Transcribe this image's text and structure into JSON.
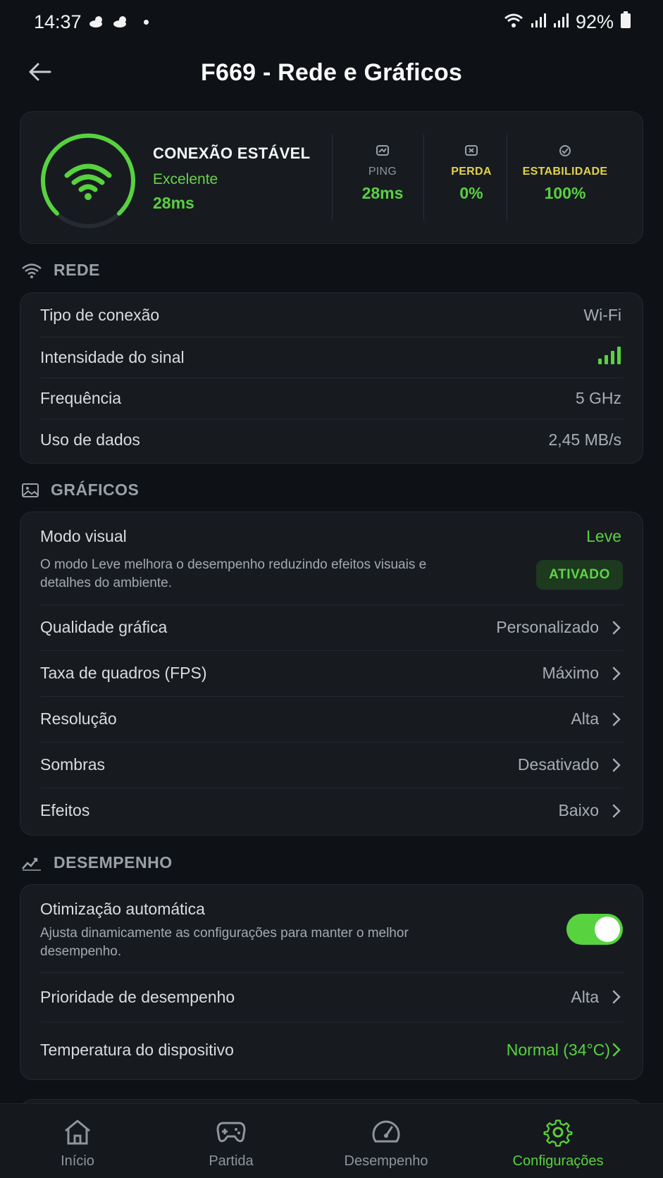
{
  "status_bar": {
    "time": "14:37",
    "battery": "92%"
  },
  "header": {
    "title": "F669 - Rede e Gráficos"
  },
  "connection": {
    "title": "CONEXÃO ESTÁVEL",
    "quality": "Excelente",
    "latency": "28ms",
    "metrics": [
      {
        "label": "PING",
        "value": "28ms",
        "label_color": "#8d939b"
      },
      {
        "label": "PERDA",
        "value": "0%",
        "label_color": "#e2d24a"
      },
      {
        "label": "ESTABILIDADE",
        "value": "100%",
        "label_color": "#e2d24a"
      }
    ]
  },
  "network": {
    "heading": "REDE",
    "rows": [
      {
        "label": "Tipo de conexão",
        "value": "Wi-Fi"
      },
      {
        "label": "Intensidade do sinal",
        "value": ""
      },
      {
        "label": "Frequência",
        "value": "5 GHz"
      },
      {
        "label": "Uso de dados",
        "value": "2,45 MB/s"
      }
    ]
  },
  "graphics": {
    "heading": "GRÁFICOS",
    "visual_mode": {
      "label": "Modo visual",
      "value": "Leve",
      "description": "O modo Leve melhora o desempenho reduzindo efeitos visuais e detalhes do ambiente.",
      "badge": "ATIVADO"
    },
    "rows": [
      {
        "label": "Qualidade gráfica",
        "value": "Personalizado"
      },
      {
        "label": "Taxa de quadros (FPS)",
        "value": "Máximo"
      },
      {
        "label": "Resolução",
        "value": "Alta"
      },
      {
        "label": "Sombras",
        "value": "Desativado"
      },
      {
        "label": "Efeitos",
        "value": "Baixo"
      }
    ]
  },
  "performance": {
    "heading": "DESEMPENHO",
    "auto_opt": {
      "label": "Otimização automática",
      "description": "Ajusta dinamicamente as configurações para manter o melhor desempenho.",
      "enabled": true
    },
    "priority": {
      "label": "Prioridade de desempenho",
      "value": "Alta"
    },
    "temperature": {
      "label": "Temperatura do dispositivo",
      "value": "Normal (34°C)"
    }
  },
  "nav": [
    {
      "label": "Início",
      "icon": "home-icon",
      "active": false
    },
    {
      "label": "Partida",
      "icon": "gamepad-icon",
      "active": false
    },
    {
      "label": "Desempenho",
      "icon": "speedometer-icon",
      "active": false
    },
    {
      "label": "Configurações",
      "icon": "gear-icon",
      "active": true
    }
  ],
  "colors": {
    "accent": "#59d13f",
    "background": "#0e1115",
    "card": "#171b20",
    "warning_label": "#e2d24a"
  }
}
